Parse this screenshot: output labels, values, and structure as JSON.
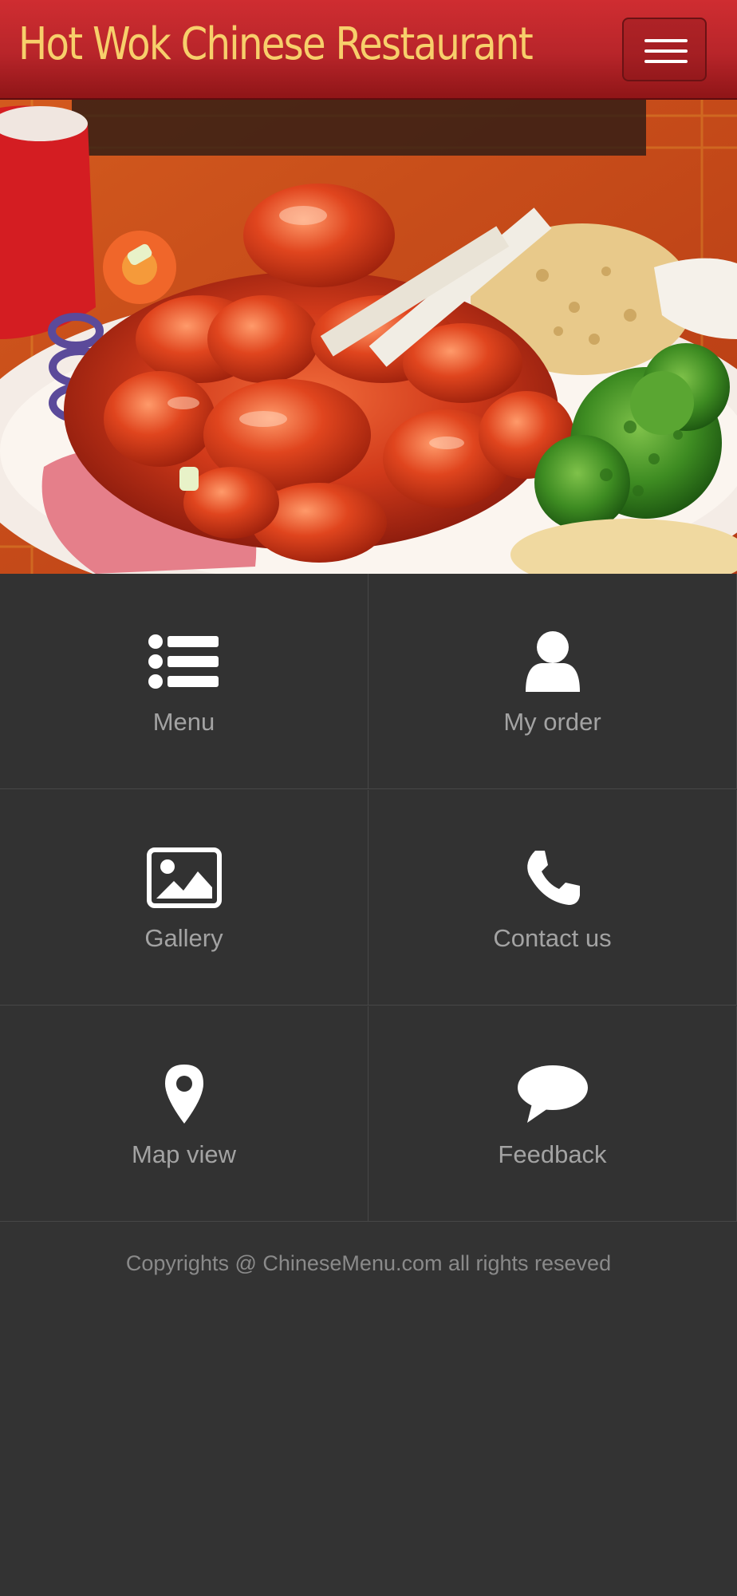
{
  "header": {
    "title": "Hot Wok Chinese Restaurant",
    "menu_toggle_icon": "hamburger-icon",
    "title_color": "#f7cf6b",
    "bar_color": "#c1282d"
  },
  "hero": {
    "image": "sweet-and-sour-chicken-photo"
  },
  "tiles": [
    {
      "label": "Menu",
      "icon": "list-icon"
    },
    {
      "label": "My order",
      "icon": "user-icon"
    },
    {
      "label": "Gallery",
      "icon": "image-icon"
    },
    {
      "label": "Contact us",
      "icon": "phone-icon"
    },
    {
      "label": "Map view",
      "icon": "map-marker-icon"
    },
    {
      "label": "Feedback",
      "icon": "chat-bubble-icon"
    }
  ],
  "footer": {
    "copyright": "Copyrights @ ChineseMenu.com all rights reseved"
  },
  "colors": {
    "background": "#333333",
    "tile_label": "#a3a3a3",
    "icon": "#ffffff"
  }
}
